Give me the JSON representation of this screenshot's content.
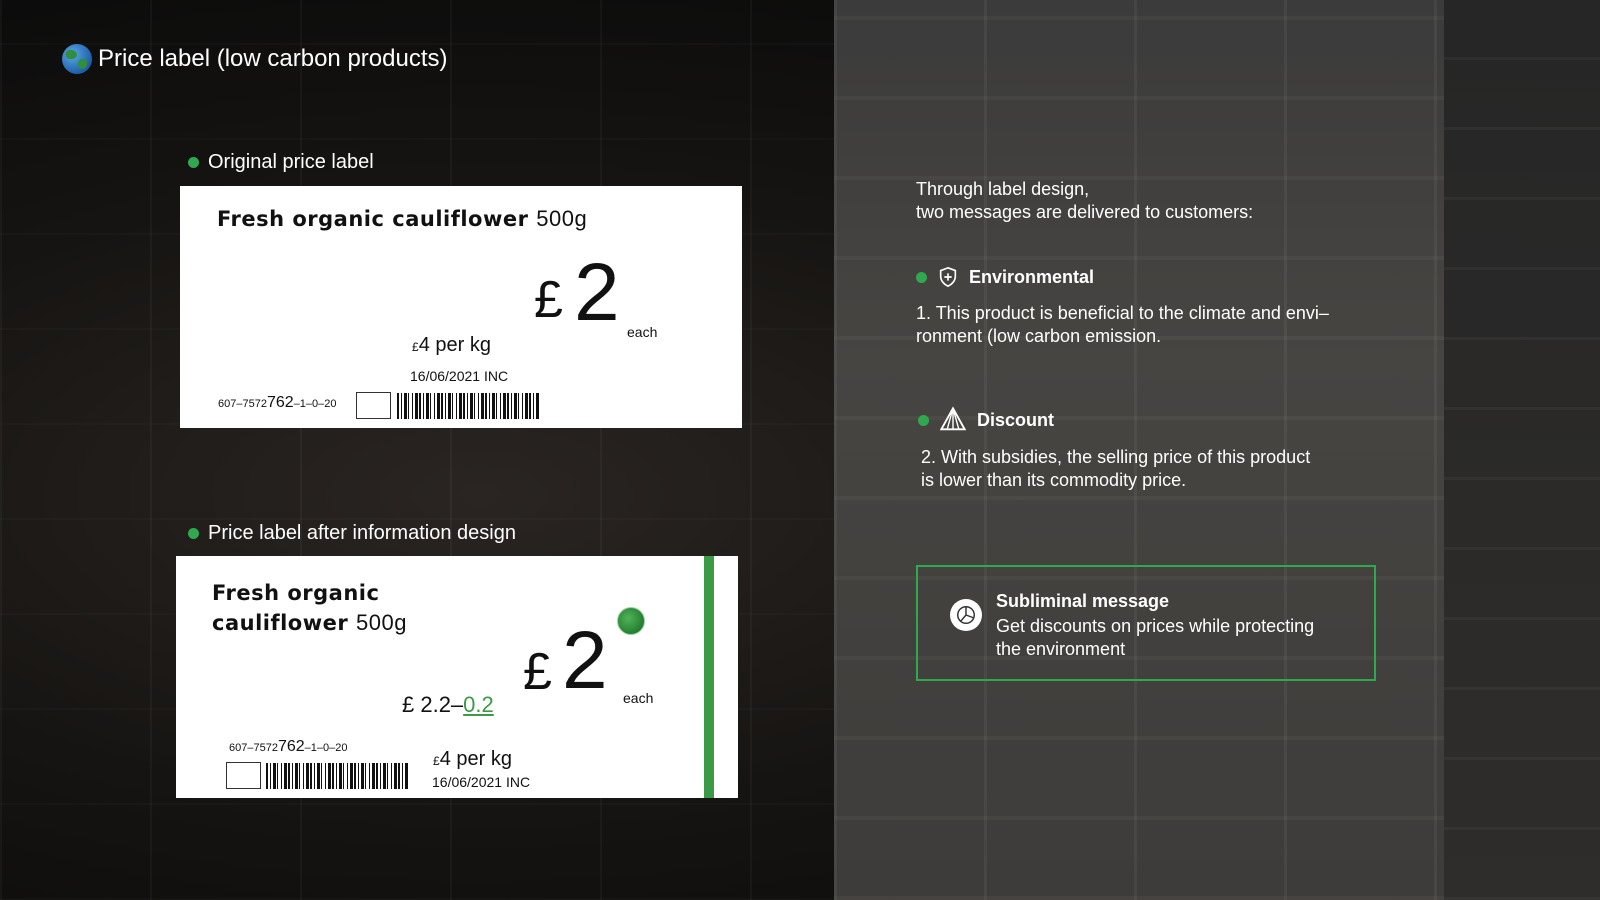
{
  "title": "Price label (low carbon products)",
  "original": {
    "section_label": "Original price label",
    "product_name": "Fresh  organic  cauliflower",
    "weight": "500g",
    "currency": "£",
    "price": "2",
    "each": "each",
    "perkg_currency": "£",
    "perkg": "4 per kg",
    "date": "16/06/2021 INC",
    "code_prefix": "607–7572",
    "code_main": "762",
    "code_suffix": "–1–0–20"
  },
  "redesigned": {
    "section_label": "Price label after information design",
    "product_name_line1": "Fresh  organic",
    "product_name_line2": "cauliflower",
    "weight": "500g",
    "currency": "£",
    "price": "2",
    "each": "each",
    "sub_price_base": "£ 2.2–",
    "sub_price_discount": "0.2",
    "perkg_currency": "£",
    "perkg": "4 per kg",
    "date": "16/06/2021 INC",
    "code_prefix": "607–7572",
    "code_main": "762",
    "code_suffix": "–1–0–20",
    "accent_color": "#3a9a45"
  },
  "intro": {
    "line1": "Through label design,",
    "line2": "two messages are delivered to customers:"
  },
  "environmental": {
    "heading": "Environmental",
    "line1": "1. This product is beneficial to the climate and envi–",
    "line2": "ronment  (low carbon emission."
  },
  "discount": {
    "heading": "Discount",
    "line1": "2. With subsidies, the selling price of this product",
    "line2": "is lower than its commodity price."
  },
  "subliminal": {
    "heading": "Subliminal message",
    "line1": "Get discounts on prices while protecting",
    "line2": "the environment"
  },
  "colors": {
    "accent_green": "#2fa84f"
  },
  "icons": {
    "title": "globe-icon",
    "environmental": "shield-plus-icon",
    "discount": "triangle-icon",
    "subliminal": "pie-chart-icon",
    "label_badge": "earth-icon"
  }
}
